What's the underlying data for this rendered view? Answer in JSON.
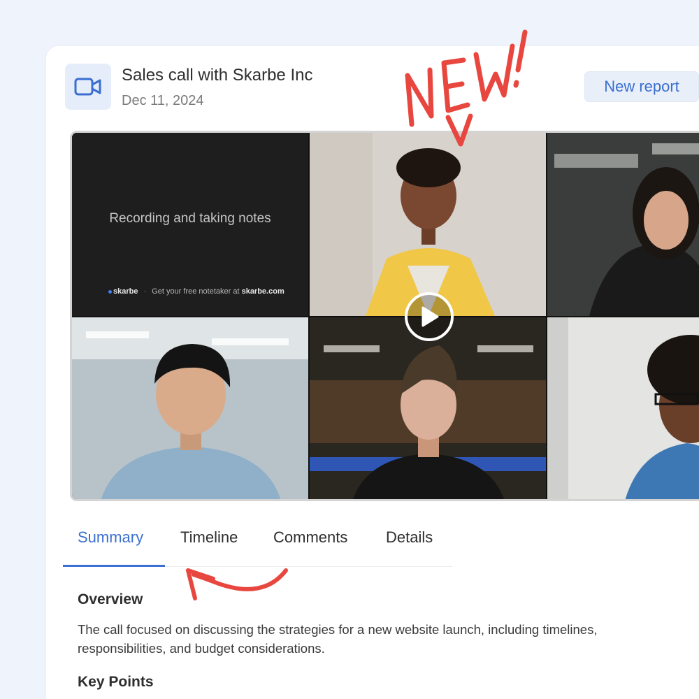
{
  "header": {
    "title": "Sales call with Skarbe Inc",
    "date": "Dec 11, 2024",
    "icon": "video-camera-icon",
    "new_report_label": "New report"
  },
  "video": {
    "recording_text": "Recording and taking notes",
    "footer_brand": "skarbe",
    "footer_separator": "·",
    "footer_prefix": "Get your free notetaker at",
    "footer_link": "skarbe.com",
    "play_icon": "play-icon"
  },
  "tabs": [
    {
      "label": "Summary",
      "active": true
    },
    {
      "label": "Timeline",
      "active": false
    },
    {
      "label": "Comments",
      "active": false
    },
    {
      "label": "Details",
      "active": false
    }
  ],
  "summary": {
    "overview_heading": "Overview",
    "overview_text": "The call focused on discussing the strategies for a new website launch, including timelines, responsibilities, and budget considerations.",
    "key_points_heading": "Key Points"
  },
  "annotation": {
    "handwritten_text": "NEW!"
  },
  "colors": {
    "accent": "#3b70cf",
    "annotation": "#e8473f",
    "background": "#eff3fb"
  }
}
